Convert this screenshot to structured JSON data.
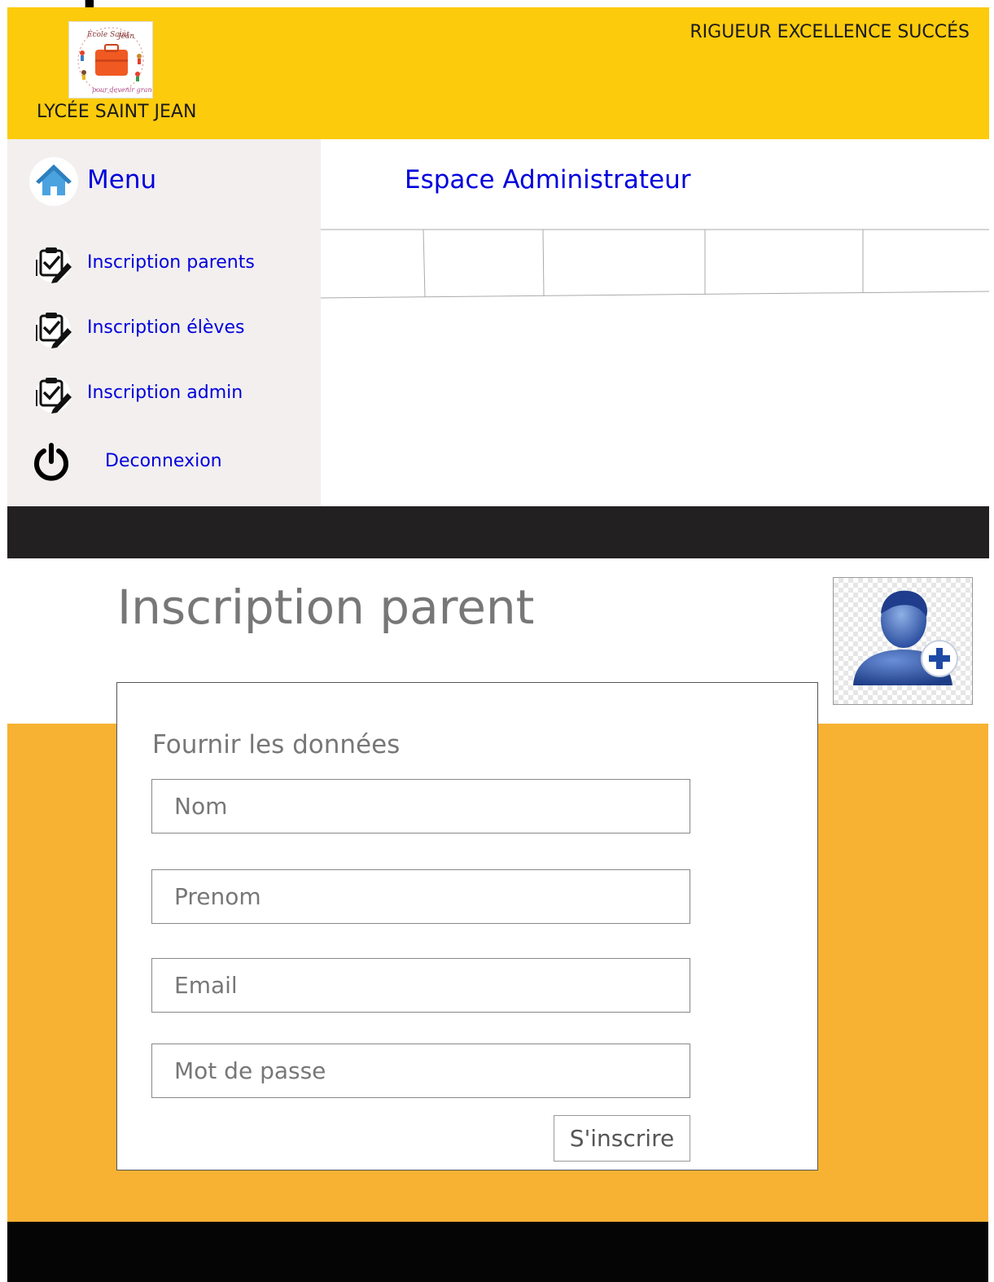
{
  "header": {
    "school_name": "LYCÉE SAINT JEAN",
    "motto": "RIGUEUR EXCELLENCE SUCCÉS",
    "logo_icon": "school-briefcase-logo-icon",
    "logo_ring_text": "École Saint - Jean · pour devenir grand",
    "bg_color": "#fccb0c"
  },
  "sidebar": {
    "title": "Menu",
    "home_icon": "home-icon",
    "items": [
      {
        "label": "Inscription parents",
        "icon": "clipboard-check-icon"
      },
      {
        "label": "Inscription élèves",
        "icon": "clipboard-check-icon"
      },
      {
        "label": "Inscription admin",
        "icon": "clipboard-check-icon"
      },
      {
        "label": "Deconnexion",
        "icon": "power-icon"
      }
    ],
    "link_color": "#0000dd"
  },
  "main": {
    "heading": "Espace Administrateur"
  },
  "form": {
    "title": "Inscription parent",
    "subtitle": "Fournir les données",
    "avatar_icon": "add-user-icon",
    "fields": {
      "nom": {
        "placeholder": "Nom",
        "value": ""
      },
      "prenom": {
        "placeholder": "Prenom",
        "value": ""
      },
      "email": {
        "placeholder": "Email",
        "value": ""
      },
      "password": {
        "placeholder": "Mot de passe",
        "value": ""
      }
    },
    "submit_label": "S'inscrire",
    "band_color": "#f7b233"
  }
}
